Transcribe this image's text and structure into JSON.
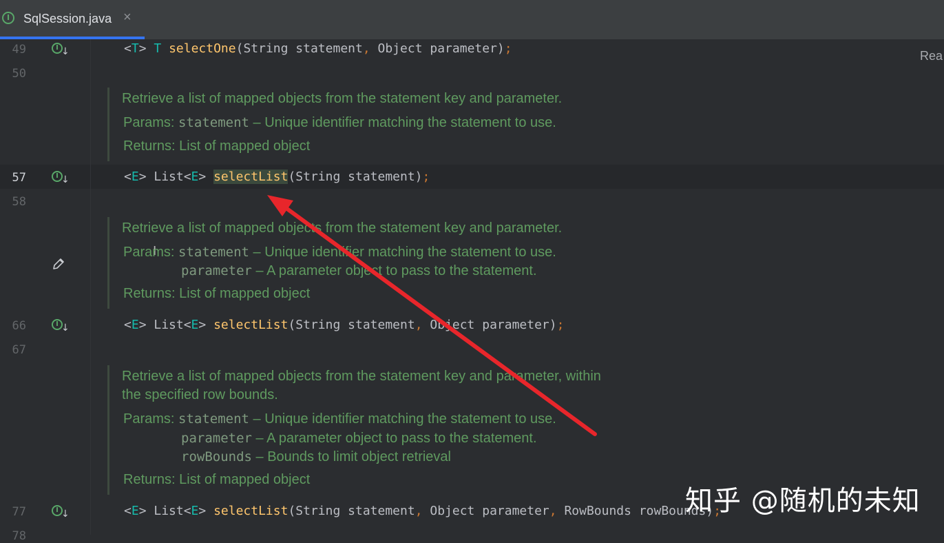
{
  "tab": {
    "label": "SqlSession.java",
    "close": "×",
    "icon": "I"
  },
  "reader_mode": "Rea",
  "lines": [
    {
      "num": "49",
      "code": "<T> T selectOne(String statement, Object parameter);"
    },
    {
      "num": "50"
    },
    {
      "num": "57",
      "active": true
    },
    {
      "num": "58"
    },
    {
      "num": "66"
    },
    {
      "num": "67"
    },
    {
      "num": "77"
    },
    {
      "num": "78"
    }
  ],
  "docs": [
    {
      "desc": [
        "Retrieve a list of mapped objects from the statement key and parameter."
      ],
      "params_label": "Params:",
      "params": [
        {
          "name": "statement",
          "sep": " – ",
          "text": "Unique identifier matching the statement to use."
        }
      ],
      "returns": "Returns: List of mapped object"
    },
    {
      "desc": [
        "Retrieve a list of mapped objects from the statement key and parameter."
      ],
      "params_label": "Params:",
      "params": [
        {
          "name": "statement",
          "sep": " – ",
          "text": "Unique identifier matching the statement to use."
        },
        {
          "name": "parameter",
          "sep": " – ",
          "text": "A parameter object to pass to the statement."
        }
      ],
      "returns": "Returns: List of mapped object"
    },
    {
      "desc": [
        "Retrieve a list of mapped objects from the statement key and parameter, within",
        "the specified row bounds."
      ],
      "params_label": "Params:",
      "params": [
        {
          "name": "statement",
          "sep": " – ",
          "text": "Unique identifier matching the statement to use."
        },
        {
          "name": "parameter",
          "sep": " – ",
          "text": "A parameter object to pass to the statement."
        },
        {
          "name": "rowBounds",
          "sep": " – ",
          "text": "Bounds to limit object retrieval"
        }
      ],
      "returns": "Returns: List of mapped object"
    }
  ],
  "code": {
    "l49": {
      "a": "<",
      "b": "T",
      "c": "> ",
      "d": "T",
      "e": " ",
      "m": "selectOne",
      "f": "(String statement",
      "g": ",",
      "h": " Object parameter)",
      "i": ";"
    },
    "l57": {
      "a": "<",
      "b": "E",
      "c": "> List<",
      "d": "E",
      "e": "> ",
      "m": "selectList",
      "f": "(String statement)",
      "i": ";"
    },
    "l66": {
      "a": "<",
      "b": "E",
      "c": "> List<",
      "d": "E",
      "e": "> ",
      "m": "selectList",
      "f": "(String statement",
      "g": ",",
      "h": " Object parameter)",
      "i": ";"
    },
    "l77": {
      "a": "<",
      "b": "E",
      "c": "> List<",
      "d": "E",
      "e": "> ",
      "m": "selectList",
      "f": "(String statement",
      "g": ",",
      "h": " Object parameter",
      "g2": ",",
      "h2": " RowBounds rowBounds)",
      "i": ";"
    }
  },
  "watermark": "知乎 @随机的未知",
  "colors": {
    "annotation_arrow": "#e8262b",
    "doc_text": "#5f9a5f",
    "method": "#ffc66d"
  }
}
